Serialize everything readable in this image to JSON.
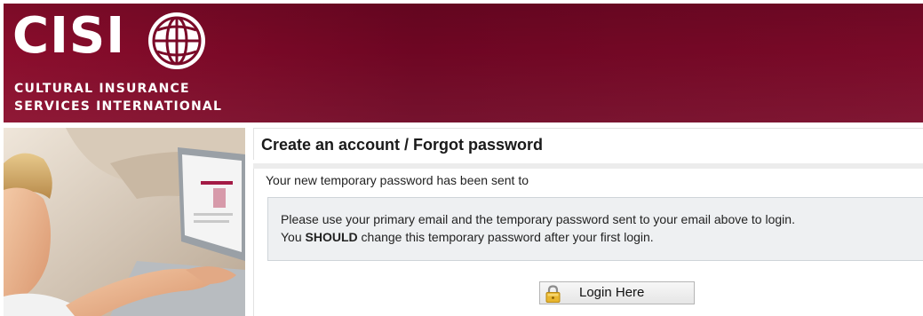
{
  "brand": {
    "wordmark": "CISI",
    "tagline_line1": "CULTURAL INSURANCE",
    "tagline_line2": "SERVICES INTERNATIONAL",
    "icon": "globe-icon",
    "colors": {
      "header": "#7a0a28",
      "text": "#ffffff"
    }
  },
  "panel": {
    "title": "Create an account / Forgot password",
    "notice": "Your new temporary password has been sent to",
    "info_line1": "Please use your primary email and the temporary password sent to your email above to login.",
    "info_line2_prefix": "You ",
    "info_line2_emphasis": "SHOULD",
    "info_line2_suffix": " change this temporary password after your first login."
  },
  "login": {
    "label": "Login Here",
    "icon": "lock-icon"
  }
}
